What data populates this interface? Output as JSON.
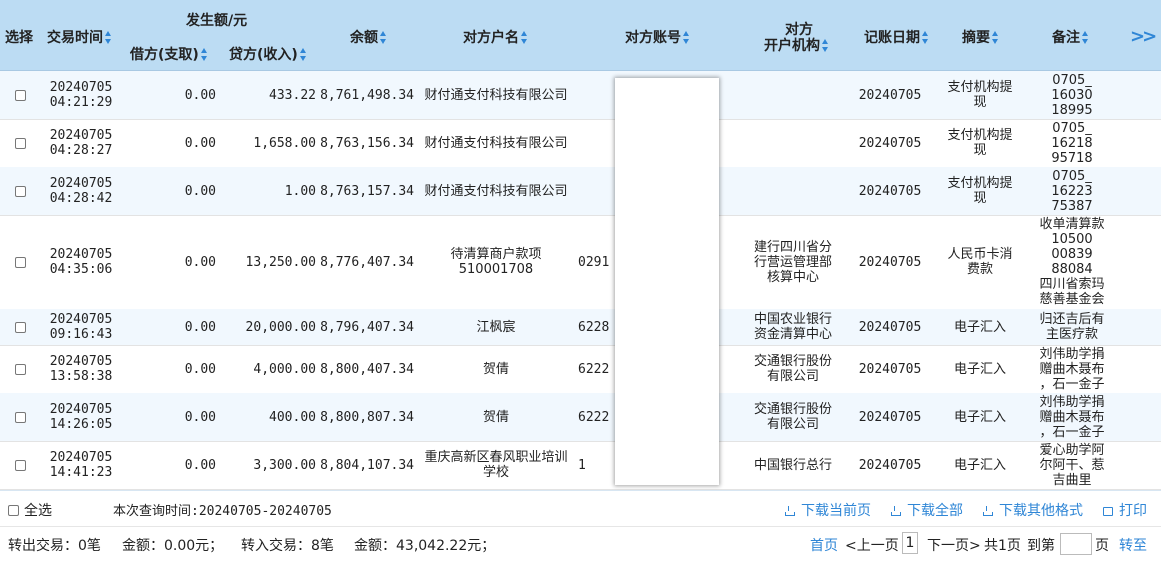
{
  "header": {
    "select": "选择",
    "time": "交易时间",
    "amount_group": "发生额/元",
    "debit": "借方(支取)",
    "credit": "贷方(收入)",
    "balance": "余额",
    "counterparty_name": "对方户名",
    "counterparty_account": "对方账号",
    "counterparty_bank_1": "对方",
    "counterparty_bank_2": "开户机构",
    "post_date": "记账日期",
    "summary": "摘要",
    "note": "备注",
    "more": ">>"
  },
  "rows": [
    {
      "date": "20240705",
      "time": "04:21:29",
      "debit": "0.00",
      "credit": "433.22",
      "balance": "8,761,498.34",
      "name": "财付通支付科技有限公司",
      "account": "",
      "bank": "",
      "post_date": "20240705",
      "summary": "支付机构提现",
      "note": "0705_1603018995"
    },
    {
      "date": "20240705",
      "time": "04:28:27",
      "debit": "0.00",
      "credit": "1,658.00",
      "balance": "8,763,156.34",
      "name": "财付通支付科技有限公司",
      "account": "",
      "bank": "",
      "post_date": "20240705",
      "summary": "支付机构提现",
      "note": "0705_1621895718"
    },
    {
      "date": "20240705",
      "time": "04:28:42",
      "debit": "0.00",
      "credit": "1.00",
      "balance": "8,763,157.34",
      "name": "财付通支付科技有限公司",
      "account": "",
      "bank": "",
      "post_date": "20240705",
      "summary": "支付机构提现",
      "note": "0705_1622375387"
    },
    {
      "date": "20240705",
      "time": "04:35:06",
      "debit": "0.00",
      "credit": "13,250.00",
      "balance": "8,776,407.34",
      "name": "待清算商户款项510001708",
      "account": "0291",
      "bank": "建行四川省分行营运管理部核算中心",
      "post_date": "20240705",
      "summary": "人民币卡消费款",
      "note": "收单清算款105000083988084四川省索玛慈善基金会"
    },
    {
      "date": "20240705",
      "time": "09:16:43",
      "debit": "0.00",
      "credit": "20,000.00",
      "balance": "8,796,407.34",
      "name": "江枫宸",
      "account": "6228",
      "bank": "中国农业银行资金清算中心",
      "post_date": "20240705",
      "summary": "电子汇入",
      "note": "归还吉后有主医疗款"
    },
    {
      "date": "20240705",
      "time": "13:58:38",
      "debit": "0.00",
      "credit": "4,000.00",
      "balance": "8,800,407.34",
      "name": "贺倩",
      "account": "6222",
      "bank": "交通银行股份有限公司",
      "post_date": "20240705",
      "summary": "电子汇入",
      "note": "刘伟助学捐赠曲木聂布，石一金子"
    },
    {
      "date": "20240705",
      "time": "14:26:05",
      "debit": "0.00",
      "credit": "400.00",
      "balance": "8,800,807.34",
      "name": "贺倩",
      "account": "6222",
      "bank": "交通银行股份有限公司",
      "post_date": "20240705",
      "summary": "电子汇入",
      "note": "刘伟助学捐赠曲木聂布，石一金子"
    },
    {
      "date": "20240705",
      "time": "14:41:23",
      "debit": "0.00",
      "credit": "3,300.00",
      "balance": "8,804,107.34",
      "name": "重庆高新区春风职业培训学校",
      "account": "1",
      "bank": "中国银行总行",
      "post_date": "20240705",
      "summary": "电子汇入",
      "note": "爱心助学阿尔阿干、惹吉曲里"
    }
  ],
  "footer": {
    "select_all": "全选",
    "query_range": "本次查询时间:20240705-20240705",
    "download_page": "下载当前页",
    "download_all": "下载全部",
    "download_other": "下载其他格式",
    "print": "打印",
    "out_count": "转出交易：0笔",
    "out_amount": "金额：0.00元；",
    "in_count": "转入交易：8笔",
    "in_amount": "金额：43,042.22元；",
    "first_page": "首页",
    "prev_page": "<上一页",
    "current_page": "1",
    "next_page": "下一页>",
    "total_pages": "共1页",
    "goto_label": "到第",
    "page_unit": "页",
    "goto_button": "转至"
  }
}
